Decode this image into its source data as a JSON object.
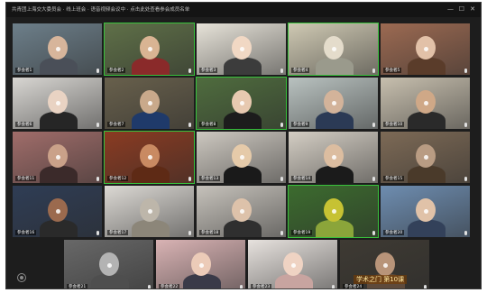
{
  "window": {
    "title": "共青团上海交大委员会 · 线上班会 · 语音视频会议中 · 点击此处查看参会成员名单",
    "controls": {
      "minimize": "—",
      "maximize": "☐",
      "close": "✕"
    }
  },
  "tiles": [
    [
      {
        "name": "参会者1",
        "bg": "#6d7f8a",
        "skin": "#d7b59b",
        "shirt": "#4a4f58",
        "active": false
      },
      {
        "name": "参会者2",
        "bg": "#5f7048",
        "skin": "#d9b493",
        "shirt": "#8a2a2a",
        "active": true
      },
      {
        "name": "参会者3",
        "bg": "#e7e3d9",
        "skin": "#f1d8c4",
        "shirt": "#3c3c3c",
        "active": false
      },
      {
        "name": "参会者4",
        "bg": "#cfc9b3",
        "skin": "#e4dccb",
        "shirt": "#9a9a8c",
        "active": true
      },
      {
        "name": "参会者5",
        "bg": "#9c6a52",
        "skin": "#e2c1a8",
        "shirt": "#5a3c2a",
        "active": false
      }
    ],
    [
      {
        "name": "参会者6",
        "bg": "#d8d6d2",
        "skin": "#e9d3c3",
        "shirt": "#262626",
        "active": false
      },
      {
        "name": "参会者7",
        "bg": "#68604c",
        "skin": "#c9a98b",
        "shirt": "#1f3a6a",
        "active": false
      },
      {
        "name": "参会者8",
        "bg": "#4f6c3e",
        "skin": "#e7c9b0",
        "shirt": "#1c1c1c",
        "active": true
      },
      {
        "name": "参会者9",
        "bg": "#b9c2c0",
        "skin": "#d3b39a",
        "shirt": "#2b3a55",
        "active": false
      },
      {
        "name": "参会者10",
        "bg": "#c7bfae",
        "skin": "#cfa887",
        "shirt": "#2a2a2a",
        "active": false
      }
    ],
    [
      {
        "name": "参会者11",
        "bg": "#a06d6a",
        "skin": "#caa189",
        "shirt": "#3b2a2a",
        "active": false
      },
      {
        "name": "参会者12",
        "bg": "#8a3b22",
        "skin": "#c98a62",
        "shirt": "#5e2a15",
        "active": true
      },
      {
        "name": "参会者13",
        "bg": "#cdc8c0",
        "skin": "#e5caa9",
        "shirt": "#1a1a1a",
        "active": false
      },
      {
        "name": "参会者14",
        "bg": "#d4cec4",
        "skin": "#dcbda0",
        "shirt": "#1b1b1b",
        "active": false
      },
      {
        "name": "参会者15",
        "bg": "#7d6a56",
        "skin": "#b99c83",
        "shirt": "#4a3a2a",
        "active": false
      }
    ],
    [
      {
        "name": "参会者16",
        "bg": "#2f3d55",
        "skin": "#9b6a4e",
        "shirt": "#2a2a2a",
        "active": false
      },
      {
        "name": "参会者17",
        "bg": "#dcd9d4",
        "skin": "#bdb6aa",
        "shirt": "#8c8679",
        "active": false
      },
      {
        "name": "参会者18",
        "bg": "#c6c2bb",
        "skin": "#ddc2aa",
        "shirt": "#2f2f2f",
        "active": false
      },
      {
        "name": "参会者19",
        "bg": "#3c6b2e",
        "skin": "#c6c233",
        "shirt": "#8ba53a",
        "active": true
      },
      {
        "name": "参会者20",
        "bg": "#6e8db0",
        "skin": "#e0c2a8",
        "shirt": "#33415a",
        "active": false
      }
    ],
    [
      {
        "name": "参会者21",
        "bg": "#686868",
        "skin": "#b3b3b3",
        "shirt": "#4e4e4e",
        "active": false
      },
      {
        "name": "参会者22",
        "bg": "#d9b3b4",
        "skin": "#eccbb8",
        "shirt": "#3a3a48",
        "active": false
      },
      {
        "name": "参会者23",
        "bg": "#e7e2de",
        "skin": "#efd3c3",
        "shirt": "#c8a4a0",
        "active": false
      },
      {
        "name": "参会者24",
        "bg": "#3e3a33",
        "skin": "#b89479",
        "shirt": "#5e4a3b",
        "active": false
      }
    ]
  ],
  "overlay": {
    "caption": "学术之门 第10课"
  }
}
